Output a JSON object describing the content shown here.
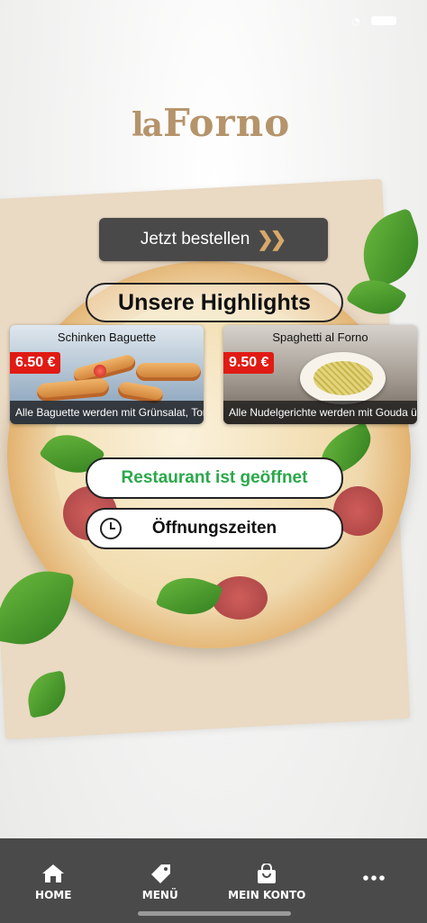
{
  "brand": {
    "logo_la": "la",
    "logo_forno": "Forno",
    "accent": "#b5946b"
  },
  "order": {
    "label": "Jetzt bestellen"
  },
  "highlights": {
    "title": "Unsere Highlights",
    "items": [
      {
        "name": "Schinken Baguette",
        "price": "6.50 €",
        "description": "Alle Baguette werden mit Grünsalat, Tom..."
      },
      {
        "name": "Spaghetti al Forno",
        "price": "9.50 €",
        "description": "Alle Nudelgerichte werden mit Gouda übe..."
      }
    ]
  },
  "status": {
    "label": "Restaurant ist geöffnet",
    "color": "#2aa84a"
  },
  "hours": {
    "label": "Öffnungszeiten",
    "icon": "clock-icon"
  },
  "nav": {
    "items": [
      {
        "label": "HOME",
        "icon": "home-icon"
      },
      {
        "label": "MENÜ",
        "icon": "tag-icon"
      },
      {
        "label": "MEIN KONTO",
        "icon": "bag-icon"
      },
      {
        "label": "",
        "icon": "more-icon"
      }
    ]
  }
}
